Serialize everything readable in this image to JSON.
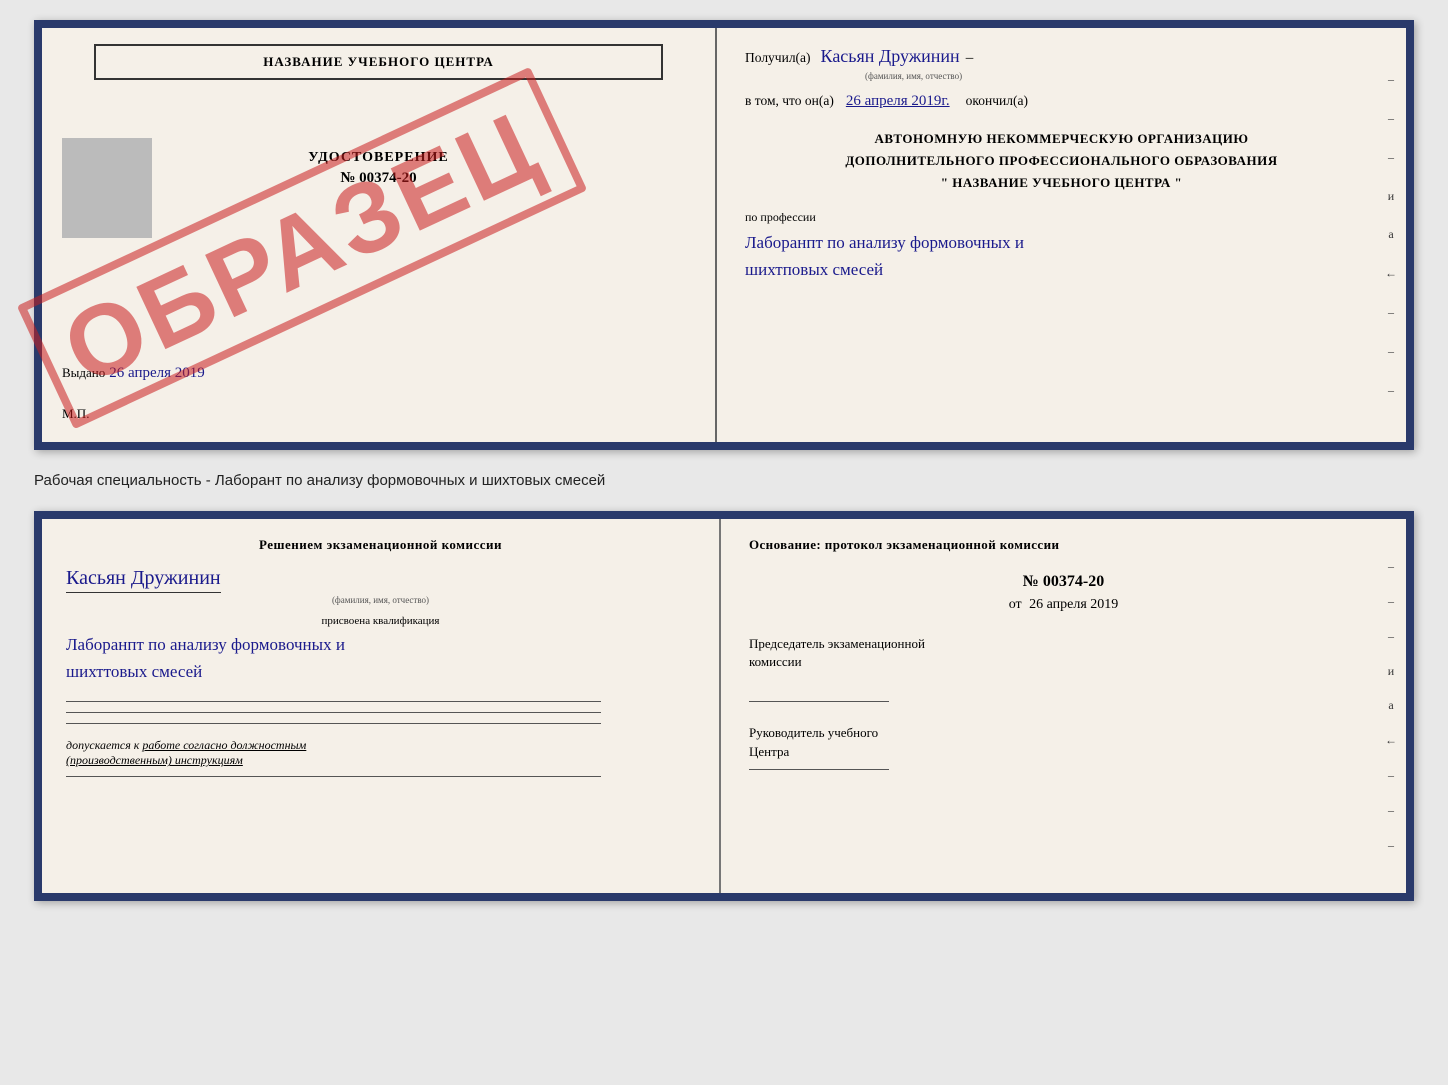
{
  "top_cert": {
    "left": {
      "school_name": "НАЗВАНИЕ УЧЕБНОГО ЦЕНТРА",
      "udostoverenie_label": "УДОСТОВЕРЕНИЕ",
      "cert_number": "№ 00374-20",
      "vydano": "Выдано",
      "vydano_date": "26 апреля 2019",
      "mp": "М.П.",
      "stamp": "ОБРАЗЕЦ"
    },
    "right": {
      "poluchil": "Получил(а)",
      "name_handwritten": "Касьян Дружинин",
      "fio_subtitle": "(фамилия, имя, отчество)",
      "vtom_prefix": "в том, что он(а)",
      "date_handwritten": "26 апреля 2019г.",
      "okonchil": "окончил(а)",
      "org_line1": "АВТОНОМНУЮ НЕКОММЕРЧЕСКУЮ ОРГАНИЗАЦИЮ",
      "org_line2": "ДОПОЛНИТЕЛЬНОГО ПРОФЕССИОНАЛЬНОГО ОБРАЗОВАНИЯ",
      "org_line3": "\"   НАЗВАНИЕ УЧЕБНОГО ЦЕНТРА   \"",
      "po_professii": "по профессии",
      "profession_handwritten": "Лаборанпт по анализу формовочных и\nшихтповых смесей",
      "side_dashes": [
        "-",
        "-",
        "-",
        "и",
        "а",
        "←",
        "-",
        "-",
        "-"
      ]
    }
  },
  "specialty_text": "Рабочая специальность - Лаборант по анализу формовочных и шихтовых смесей",
  "bottom_cert": {
    "left": {
      "resheniem": "Решением экзаменационной комиссии",
      "name_handwritten": "Касьян Дружинин",
      "fio_subtitle": "(фамилия, имя, отчество)",
      "prisvoena": "присвоена квалификация",
      "qualification_handwritten": "Лаборанпт по анализу формовочных и\nшихттовых смесей",
      "dopuskaetsya": "допускается к",
      "dopuskaetsya_underline": "работе согласно должностным\n(производственным) инструкциям"
    },
    "right": {
      "osnovanie": "Основание: протокол экзаменационной комиссии",
      "protocol_number": "№ 00374-20",
      "ot_prefix": "от",
      "protocol_date": "26 апреля 2019",
      "predsedatel": "Председатель экзаменационной\nкомиссии",
      "rukovoditel": "Руководитель учебного\nЦентра",
      "side_dashes": [
        "-",
        "-",
        "-",
        "и",
        "а",
        "←",
        "-",
        "-",
        "-"
      ]
    }
  }
}
